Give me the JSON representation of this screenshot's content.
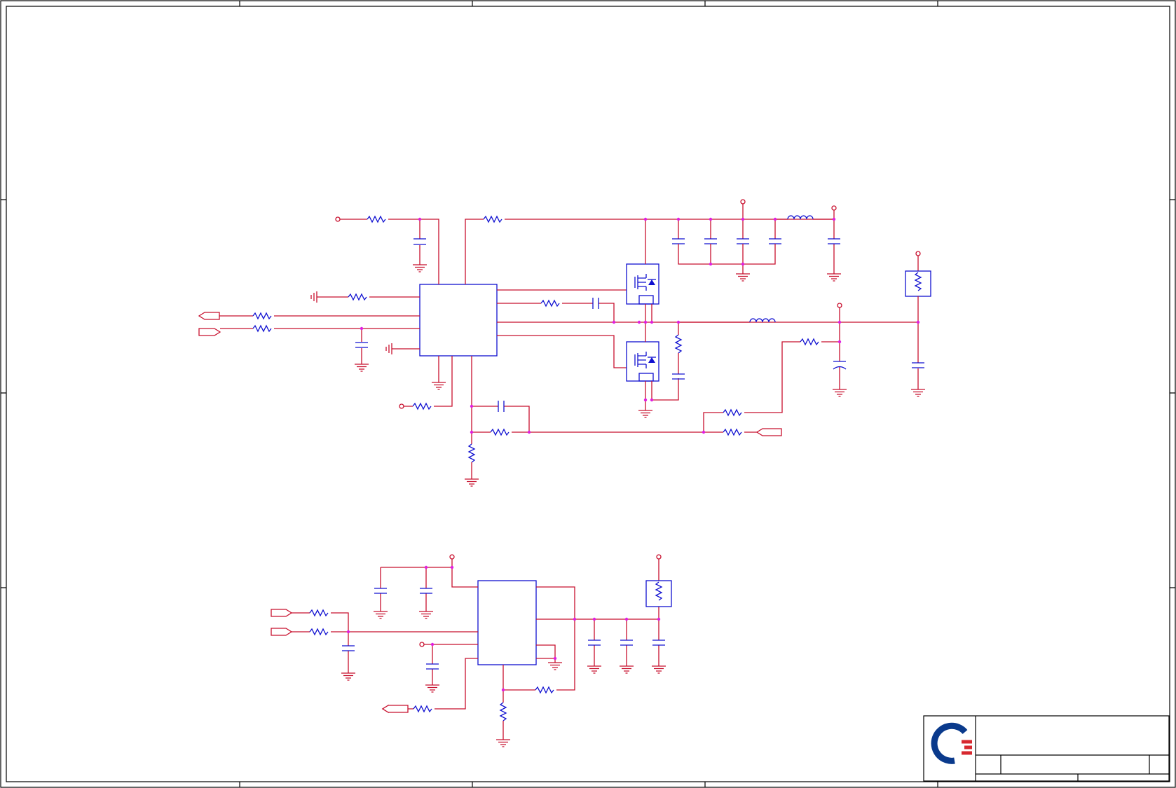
{
  "sheet": {
    "type": "schematic",
    "border_zones": {
      "columns": 5,
      "rows": 4
    }
  },
  "title_block": {
    "logo_name": "company-logo",
    "logo_colors": {
      "ring": "#0a3a8c",
      "stripes": "#d7282f"
    },
    "title": "",
    "size": "",
    "document_number": "",
    "revision": "",
    "date": "",
    "sheet": ""
  },
  "circuits": [
    {
      "name": "upper-dc-dc-buck-converter",
      "ic": "controller",
      "mosfets": 2,
      "inductors": 2
    },
    {
      "name": "lower-regulator",
      "ic": "regulator",
      "mosfets": 0,
      "inductors": 0
    }
  ],
  "colors": {
    "wire": "#c8102e",
    "part": "#1010d0",
    "junction": "#e020e0",
    "frame": "#000000"
  }
}
